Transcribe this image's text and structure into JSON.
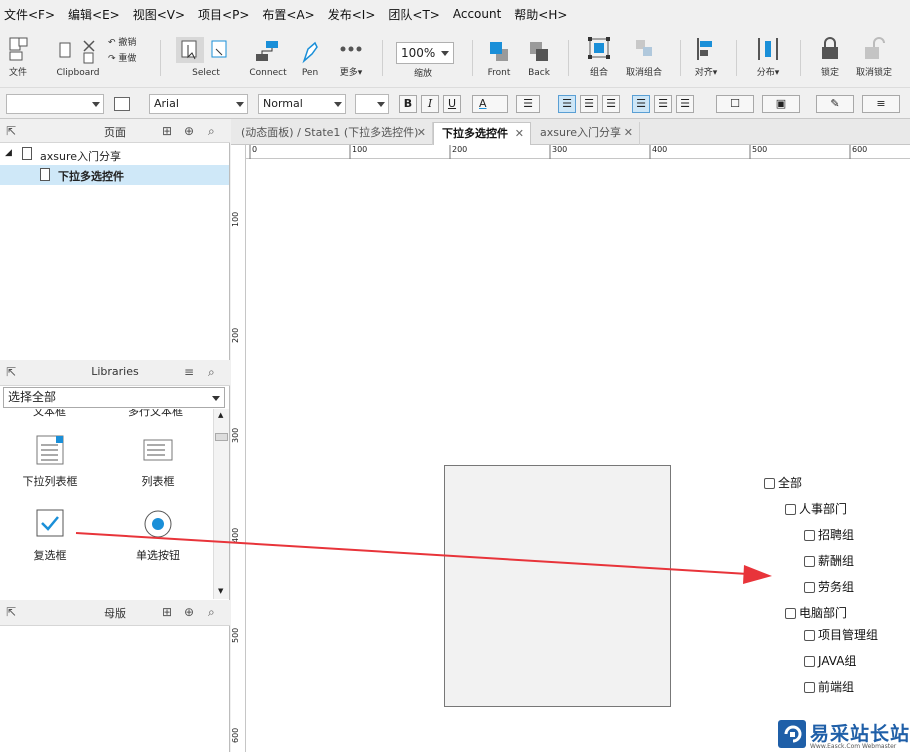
{
  "menu": [
    "文件<F>",
    "编辑<E>",
    "视图<V>",
    "项目<P>",
    "布置<A>",
    "发布<I>",
    "团队<T>",
    "Account",
    "帮助<H>"
  ],
  "toolbar": {
    "file": "文件",
    "clipboard": "Clipboard",
    "undo": "撤销",
    "redo": "重做",
    "select": "Select",
    "connect": "Connect",
    "pen": "Pen",
    "more": "更多▾",
    "zoom_value": "100%",
    "zoom_label": "缩放",
    "front": "Front",
    "back": "Back",
    "group": "组合",
    "ungroup": "取消组合",
    "align": "对齐▾",
    "distribute": "分布▾",
    "lock": "锁定",
    "unlock": "取消锁定"
  },
  "format": {
    "style_value": "",
    "font_value": "Arial",
    "weight_value": "Normal",
    "size_value": "",
    "bold": "B",
    "italic": "I",
    "underline": "U",
    "font_color": "A"
  },
  "pages_panel": {
    "title": "页面",
    "root": "axsure入门分享",
    "child": "下拉多选控件"
  },
  "libraries_panel": {
    "title": "Libraries",
    "select_value": "选择全部",
    "cut_labels": [
      "文本框",
      "多行文本框"
    ],
    "items": [
      "下拉列表框",
      "列表框",
      "复选框",
      "单选按钮"
    ]
  },
  "masters_panel": {
    "title": "母版"
  },
  "tabs": [
    {
      "label": "(动态面板) / State1 (下拉多选控件)"
    },
    {
      "label": "下拉多选控件"
    },
    {
      "label": "axsure入门分享"
    }
  ],
  "ruler": {
    "h_ticks": [
      "0",
      "100",
      "200",
      "300",
      "400",
      "500",
      "600"
    ],
    "v_ticks": [
      "100",
      "200",
      "300",
      "400",
      "500",
      "600"
    ]
  },
  "checklist": {
    "all": "全部",
    "dept1": "人事部门",
    "dept1_groups": [
      "招聘组",
      "薪酬组",
      "劳务组"
    ],
    "dept2": "电脑部门",
    "dept2_groups": [
      "项目管理组",
      "JAVA组",
      "前端组"
    ]
  },
  "watermark": {
    "name": "易采站长站",
    "sub": "Www.Easck.Com Webmaster"
  },
  "colors": {
    "arrow": "#e8343a",
    "accent": "#1a8fd8",
    "selected_row": "#cfe8f8",
    "watermark_blue": "#1f5fa8"
  }
}
